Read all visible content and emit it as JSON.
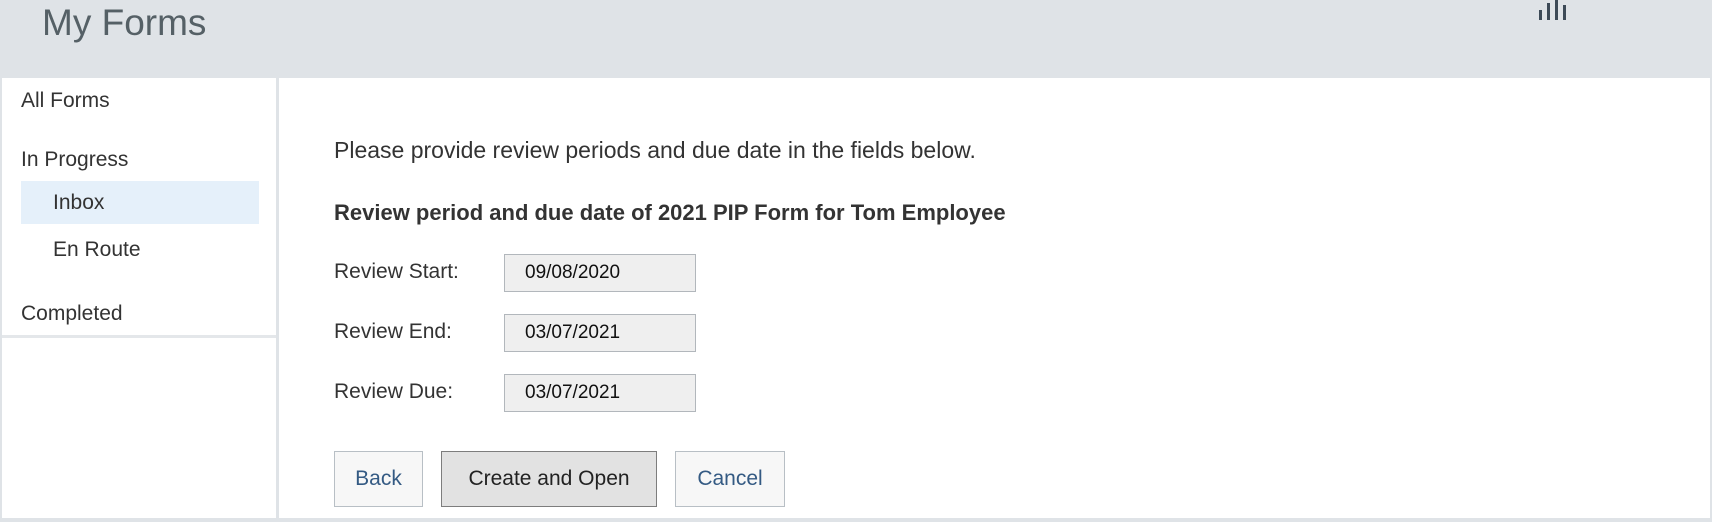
{
  "header": {
    "title": "My Forms",
    "icon": "bar-chart-icon"
  },
  "sidebar": {
    "items": [
      {
        "label": "All Forms"
      },
      {
        "label": "In Progress"
      },
      {
        "label": "Inbox",
        "selected": true
      },
      {
        "label": "En Route"
      },
      {
        "label": "Completed"
      }
    ]
  },
  "main": {
    "instruction": "Please provide review periods and due date in the fields below.",
    "heading": "Review period and due date of 2021 PIP Form for Tom Employee",
    "fields": [
      {
        "label": "Review Start:",
        "value": "09/08/2020"
      },
      {
        "label": "Review End:",
        "value": "03/07/2021"
      },
      {
        "label": "Review Due:",
        "value": "03/07/2021"
      }
    ],
    "buttons": {
      "back": "Back",
      "create_open": "Create and Open",
      "cancel": "Cancel"
    }
  },
  "colors": {
    "header_bg": "#dfe3e7",
    "selected_bg": "#e5f0fa",
    "link_text": "#345a83"
  }
}
